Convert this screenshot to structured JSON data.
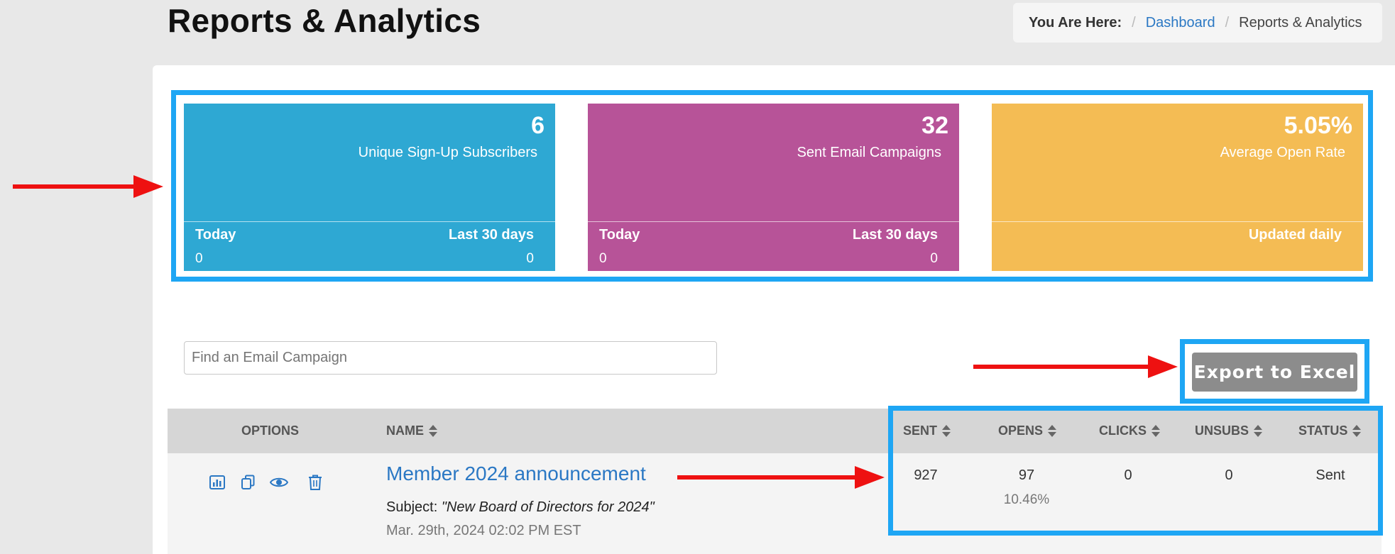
{
  "page": {
    "title": "Reports & Analytics"
  },
  "breadcrumb": {
    "here_label": "You Are Here:",
    "items": [
      "Dashboard",
      "Reports & Analytics"
    ]
  },
  "stats": [
    {
      "value": "6",
      "label": "Unique Sign-Up Subscribers",
      "footer_left": "Today",
      "footer_right": "Last 30 days",
      "left_value": "0",
      "right_value": "0",
      "color": "#2ea8d3"
    },
    {
      "value": "32",
      "label": "Sent Email Campaigns",
      "footer_left": "Today",
      "footer_right": "Last 30 days",
      "left_value": "0",
      "right_value": "0",
      "color": "#b75398"
    },
    {
      "value": "5.05%",
      "label": "Average Open Rate",
      "footer_right": "Updated daily",
      "color": "#f4bc54"
    }
  ],
  "search": {
    "placeholder": "Find an Email Campaign"
  },
  "export": {
    "label": "Export to Excel"
  },
  "table": {
    "columns": [
      "OPTIONS",
      "NAME",
      "SENT",
      "OPENS",
      "CLICKS",
      "UNSUBS",
      "STATUS"
    ],
    "rows": [
      {
        "name": "Member 2024 announcement",
        "subject_label": "Subject:",
        "subject": "\"New Board of Directors for 2024\"",
        "date": "Mar. 29th, 2024 02:02 PM EST",
        "sent": "927",
        "opens": "97",
        "open_rate": "10.46%",
        "clicks": "0",
        "unsubs": "0",
        "status": "Sent",
        "option_icons": [
          "bar-chart-icon",
          "copy-icon",
          "eye-icon",
          "trash-icon"
        ]
      }
    ]
  },
  "colors": {
    "highlight": "#1ea6f4",
    "annotation_arrow": "#ee1111",
    "link": "#2b78c4"
  }
}
